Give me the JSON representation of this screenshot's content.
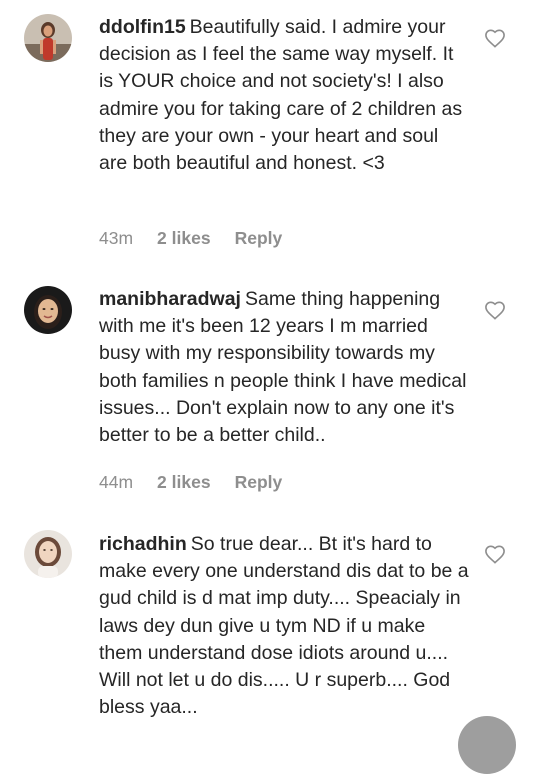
{
  "comments": [
    {
      "username": "ddolfin15",
      "text": "Beautifully said. I admire your decision as I feel the same way myself. It is YOUR choice and not society's! I also admire you for taking care of 2 children as they are your own - your heart and soul are both beautiful and honest. <3",
      "time": "43m",
      "likes": "2 likes",
      "reply": "Reply"
    },
    {
      "username": "manibharadwaj",
      "text": "Same thing happening with me it's been 12 years I m married busy with my responsibility towards my both families n people think I have medical issues... Don't explain now to any one it's better to be a better child..",
      "time": "44m",
      "likes": "2 likes",
      "reply": "Reply"
    },
    {
      "username": "richadhin",
      "text": "So true dear... Bt it's hard to make every one understand dis dat to be a gud child is d mat imp duty.... Speacialy in laws dey dun give u tym ND if u make them understand dose idiots around u.... Will not let u do dis..... U r superb.... God bless yaa...",
      "time": "",
      "likes": "",
      "reply": ""
    }
  ],
  "icons": {
    "like": "heart-outline-icon",
    "avatar_1": "avatar-photo",
    "avatar_2": "avatar-photo",
    "avatar_3": "avatar-photo"
  },
  "colors": {
    "text": "#262626",
    "meta": "#8e8e8e",
    "heart": "#8e8e8e"
  }
}
